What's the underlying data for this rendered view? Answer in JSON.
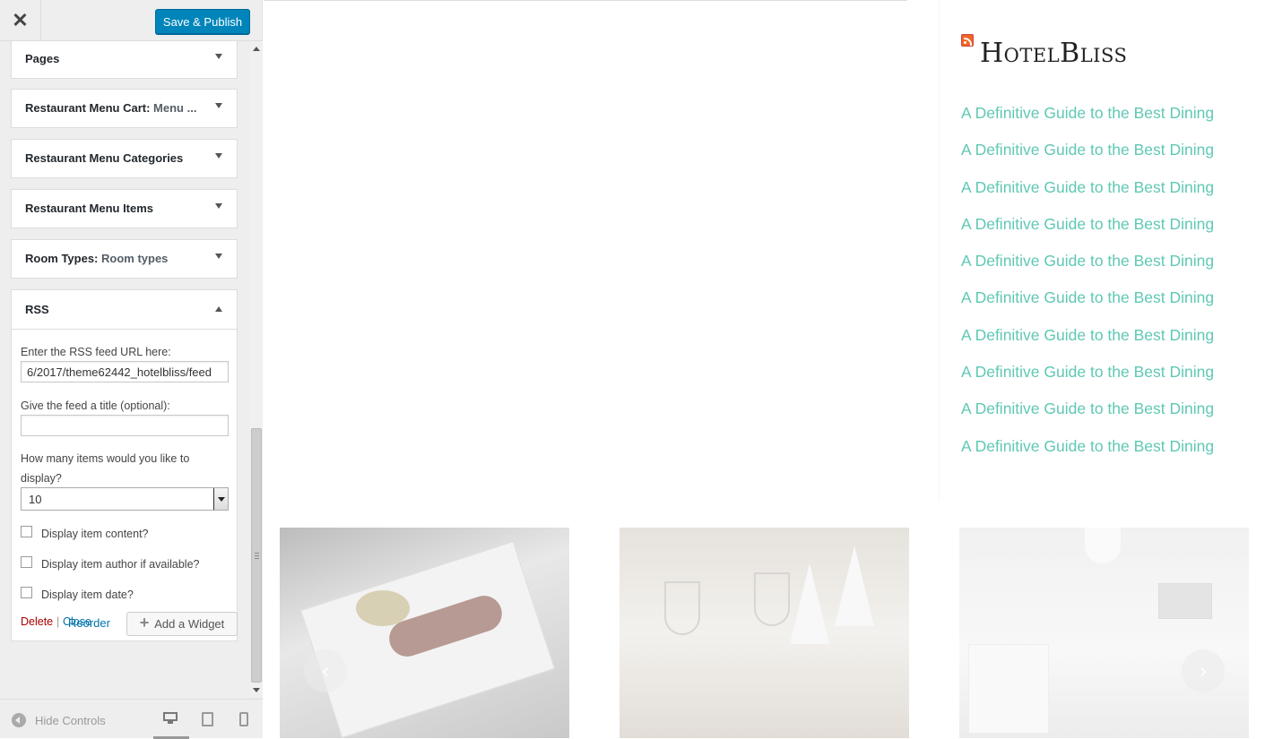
{
  "header": {
    "close_glyph": "✕",
    "save_label": "Save & Publish"
  },
  "sections": [
    {
      "title": "Pages",
      "subtitle": ""
    },
    {
      "title": "Restaurant Menu Cart:",
      "subtitle": "Menu ..."
    },
    {
      "title": "Restaurant Menu Categories",
      "subtitle": ""
    },
    {
      "title": "Restaurant Menu Items",
      "subtitle": ""
    },
    {
      "title": "Room Types:",
      "subtitle": "Room types"
    }
  ],
  "rss": {
    "title": "RSS",
    "url_label": "Enter the RSS feed URL here:",
    "url_value": "6/2017/theme62442_hotelbliss/feed",
    "title_label": "Give the feed a title (optional):",
    "title_value": "",
    "count_label_1": "How many items would you like to",
    "count_label_2": "display?",
    "count_value": "10",
    "checkboxes": [
      {
        "label": "Display item content?",
        "checked": false
      },
      {
        "label": "Display item author if available?",
        "checked": false
      },
      {
        "label": "Display item date?",
        "checked": false
      }
    ],
    "delete_label": "Delete",
    "separator": "|",
    "close_label": "Close"
  },
  "actions": {
    "reorder_label": "Reorder",
    "add_widget_plus": "+",
    "add_widget_label": "Add a Widget"
  },
  "footer": {
    "hide_controls_label": "Hide Controls",
    "devices": [
      "desktop",
      "tablet",
      "mobile"
    ],
    "active_device": "desktop"
  },
  "preview": {
    "widget_title": "HotelBliss",
    "feed_items": [
      "A Definitive Guide to the Best Dining",
      "A Definitive Guide to the Best Dining",
      "A Definitive Guide to the Best Dining",
      "A Definitive Guide to the Best Dining",
      "A Definitive Guide to the Best Dining",
      "A Definitive Guide to the Best Dining",
      "A Definitive Guide to the Best Dining",
      "A Definitive Guide to the Best Dining",
      "A Definitive Guide to the Best Dining",
      "A Definitive Guide to the Best Dining"
    ],
    "prev_glyph": "‹",
    "next_glyph": "›"
  },
  "colors": {
    "primary_button": "#0085ba",
    "feed_link": "#5fc8b4",
    "delete_link": "#aa0000",
    "link": "#0073aa"
  }
}
